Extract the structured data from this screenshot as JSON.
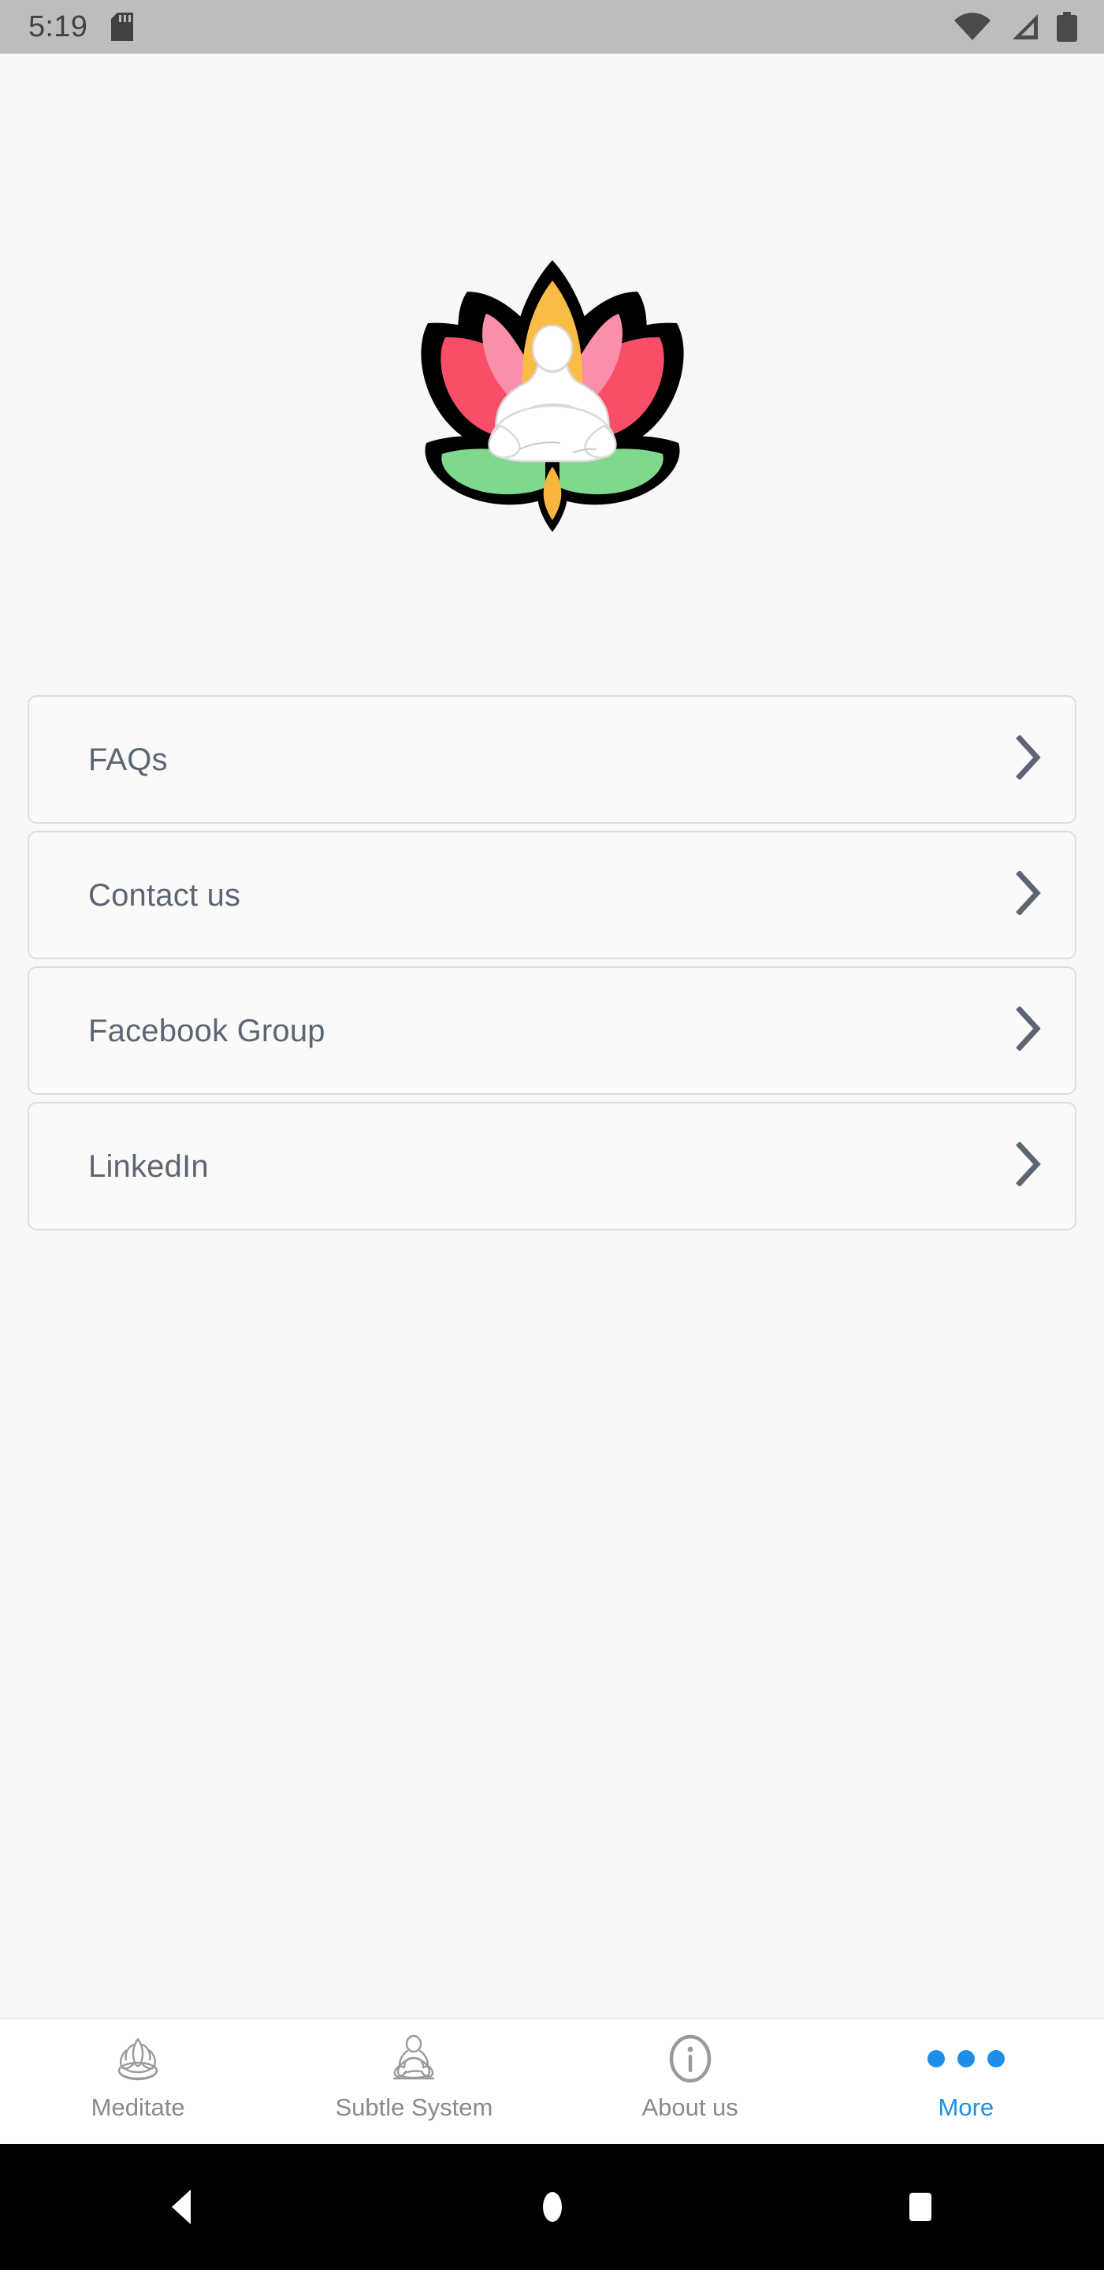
{
  "status_bar": {
    "time": "5:19",
    "icons": [
      "sd-card-icon",
      "wifi-icon",
      "cellular-signal-icon",
      "battery-icon"
    ],
    "background": "#BDBDBD",
    "foreground": "#424242"
  },
  "logo": {
    "name": "lotus-meditation-logo",
    "colors": {
      "outline": "#000000",
      "petal_rose": "#F94E68",
      "petal_light_pink": "#F98FA8",
      "center_gold": "#F9BC45",
      "leaf_green": "#7FD98C",
      "figure_white": "#FFFFFF"
    }
  },
  "menu": {
    "items": [
      {
        "label": "FAQs",
        "chevron": "chevron-right-icon"
      },
      {
        "label": "Contact us",
        "chevron": "chevron-right-icon"
      },
      {
        "label": "Facebook Group",
        "chevron": "chevron-right-icon"
      },
      {
        "label": "LinkedIn",
        "chevron": "chevron-right-icon"
      }
    ],
    "text_color": "#5C6673",
    "card_background": "#FAFAFA",
    "card_border": "#DCDCDC"
  },
  "bottom_nav": {
    "items": [
      {
        "label": "Meditate",
        "icon": "lotus-outline-icon",
        "active": false
      },
      {
        "label": "Subtle System",
        "icon": "meditating-person-outline-icon",
        "active": false
      },
      {
        "label": "About us",
        "icon": "info-circle-icon",
        "active": false
      },
      {
        "label": "More",
        "icon": "three-dots-icon",
        "active": true
      }
    ],
    "inactive_color": "#8A8A8A",
    "active_color": "#1E8FE8"
  },
  "android_nav": {
    "buttons": [
      {
        "name": "back-button",
        "icon": "triangle-left-icon"
      },
      {
        "name": "home-button",
        "icon": "circle-icon"
      },
      {
        "name": "recents-button",
        "icon": "square-icon"
      }
    ],
    "background": "#000000",
    "foreground": "#FFFFFF"
  },
  "page": {
    "background": "#F7F7F7"
  }
}
